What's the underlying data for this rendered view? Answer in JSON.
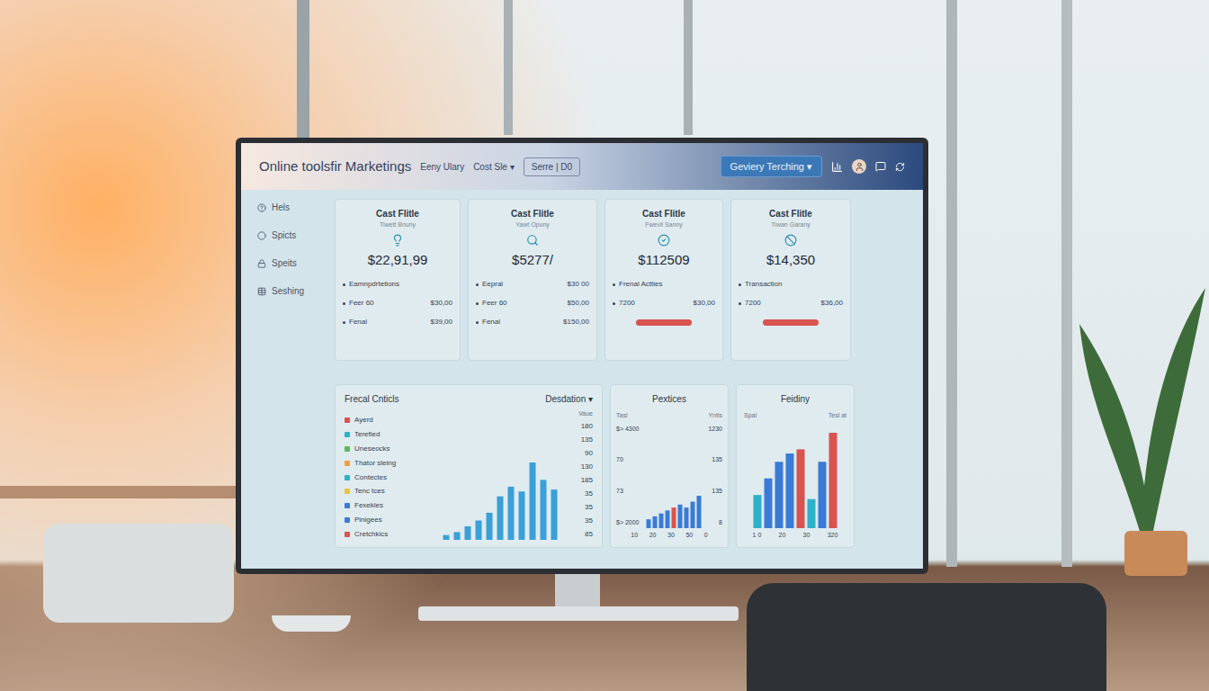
{
  "header": {
    "title": "Online toolsfir Marketings",
    "links": [
      "Eeny Ulary",
      "Cost Sle"
    ],
    "caret": "▾",
    "button": "Serre | D0",
    "dropdown": "Geviery Terching"
  },
  "sidebar": {
    "items": [
      {
        "label": "Hels"
      },
      {
        "label": "Spicts"
      },
      {
        "label": "Speits"
      },
      {
        "label": "Seshing"
      }
    ]
  },
  "cards": [
    {
      "title": "Cast Flitle",
      "subtitle": "Tiwett Bnuny",
      "value": "$22,91,99",
      "bar": false,
      "rows": [
        {
          "label": "Eamnpdrtetions",
          "value": ""
        },
        {
          "label": "Feer 60",
          "value": "$30,00"
        },
        {
          "label": "Fenal",
          "value": "$39,00"
        }
      ]
    },
    {
      "title": "Cast Flitle",
      "subtitle": "Yawt Opuny",
      "value": "$5277/",
      "bar": false,
      "rows": [
        {
          "label": "Eepral",
          "value": "$30 00"
        },
        {
          "label": "Feer 60",
          "value": "$50,00"
        },
        {
          "label": "Fenal",
          "value": "$150,00"
        }
      ]
    },
    {
      "title": "Cast Flitle",
      "subtitle": "Fwevli Sanny",
      "value": "$112509",
      "bar": true,
      "rows": [
        {
          "label": "Frenal Actties",
          "value": ""
        },
        {
          "label": "7200",
          "value": "$30,00"
        }
      ]
    },
    {
      "title": "Cast Flitle",
      "subtitle": "Tiwan Garany",
      "value": "$14,350",
      "bar": true,
      "rows": [
        {
          "label": "Transaction",
          "value": ""
        },
        {
          "label": "7200",
          "value": "$36,00"
        }
      ]
    }
  ],
  "frecal": {
    "title": "Frecal Cnticls",
    "dropdown": "Desdation",
    "value_header": "Vaue",
    "items": [
      {
        "label": "Ayerd",
        "value": "180",
        "color": "#d9534f"
      },
      {
        "label": "Terefied",
        "value": "135",
        "color": "#2eb0c9"
      },
      {
        "label": "Uneseocks",
        "value": "90",
        "color": "#5cb85c"
      },
      {
        "label": "Thator sleing",
        "value": "130",
        "color": "#f0a040"
      },
      {
        "label": "Contectes",
        "value": "185",
        "color": "#2eb0c9"
      },
      {
        "label": "Tenc tces",
        "value": "35",
        "color": "#e8c33a"
      },
      {
        "label": "Fexekles",
        "value": "35",
        "color": "#3a7bd5"
      },
      {
        "label": "Pinigees",
        "value": "35",
        "color": "#3a7bd5"
      },
      {
        "label": "Cretchkics",
        "value": "85",
        "color": "#d9534f"
      }
    ],
    "bars": [
      {
        "value": 5,
        "color": "#3ba0d8"
      },
      {
        "value": 8,
        "color": "#3ba0d8"
      },
      {
        "value": 14,
        "color": "#3ba0d8"
      },
      {
        "value": 20,
        "color": "#3ba0d8"
      },
      {
        "value": 28,
        "color": "#3ba0d8"
      },
      {
        "value": 45,
        "color": "#3ba0d8"
      },
      {
        "value": 55,
        "color": "#3ba0d8"
      },
      {
        "value": 50,
        "color": "#3ba0d8"
      },
      {
        "value": 80,
        "color": "#3ba0d8"
      },
      {
        "value": 62,
        "color": "#3ba0d8"
      },
      {
        "value": 52,
        "color": "#3ba0d8"
      }
    ]
  },
  "pextices": {
    "title": "Pextices",
    "left_header": "Tasl",
    "right_header": "Yntis",
    "left_ticks": [
      "$> 4300",
      "70",
      "73",
      "$> 2000"
    ],
    "right_ticks": [
      "1230",
      "135",
      "135",
      "8"
    ],
    "x_ticks": [
      "10",
      "20",
      "30",
      "50",
      "0"
    ],
    "bars": [
      {
        "value": 3,
        "color": "#3a7bd5"
      },
      {
        "value": 4,
        "color": "#3a7bd5"
      },
      {
        "value": 5,
        "color": "#3a7bd5"
      },
      {
        "value": 6,
        "color": "#3a7bd5"
      },
      {
        "value": 7,
        "color": "#d9534f"
      },
      {
        "value": 8,
        "color": "#3a7bd5"
      },
      {
        "value": 7,
        "color": "#3a7bd5"
      },
      {
        "value": 9,
        "color": "#3a7bd5"
      },
      {
        "value": 11,
        "color": "#3a7bd5"
      }
    ]
  },
  "feidiny": {
    "title": "Feidiny",
    "left_header": "Spal",
    "right_header": "Tesl at",
    "x_ticks": [
      "1 0",
      "20",
      "30",
      "320"
    ],
    "bars": [
      {
        "value": 40,
        "color": "#2eb0c9"
      },
      {
        "value": 60,
        "color": "#3a7bd5"
      },
      {
        "value": 80,
        "color": "#3a7bd5"
      },
      {
        "value": 90,
        "color": "#3a7bd5"
      },
      {
        "value": 95,
        "color": "#d9534f"
      },
      {
        "value": 35,
        "color": "#2eb0c9"
      },
      {
        "value": 80,
        "color": "#3a7bd5"
      },
      {
        "value": 115,
        "color": "#d9534f"
      }
    ]
  }
}
